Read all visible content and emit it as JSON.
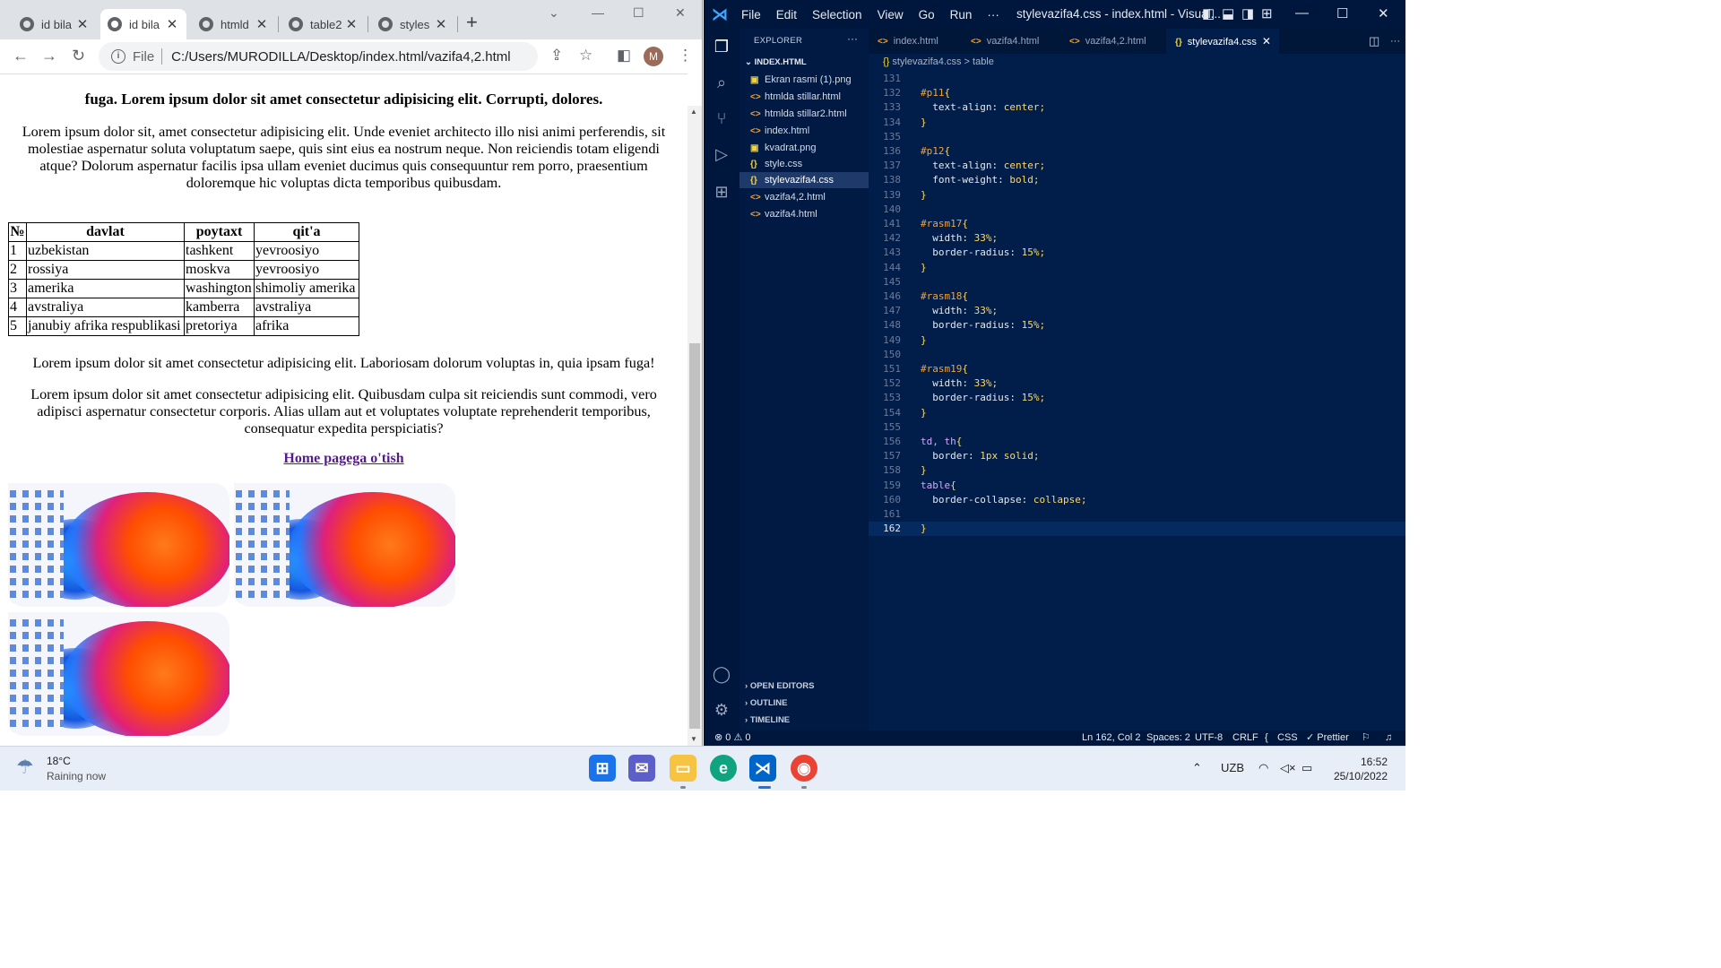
{
  "browser": {
    "tabs": [
      {
        "label": "id bila"
      },
      {
        "label": "id bila"
      },
      {
        "label": "htmld"
      },
      {
        "label": "table2"
      },
      {
        "label": "styles"
      }
    ],
    "new_tab": "+",
    "address_scheme": "File",
    "address": "C:/Users/MURODILLA/Desktop/index.html/vazifa4,2.html",
    "profile_initial": "M",
    "page": {
      "cut_heading": "fuga. Lorem ipsum dolor sit amet consectetur adipisicing elit. Corrupti, dolores.",
      "para1": "Lorem ipsum dolor sit, amet consectetur adipisicing elit. Unde eveniet architecto illo nisi animi perferendis, sit molestiae aspernatur soluta voluptatum saepe, quis sint eius ea nostrum neque. Non reiciendis totam eligendi atque? Dolorum aspernatur facilis ipsa ullam eveniet ducimus quis consequuntur rem porro, praesentium doloremque hic voluptas dicta temporibus quibusdam.",
      "table": {
        "headers": [
          "№",
          "davlat",
          "poytaxt",
          "qit'a"
        ],
        "rows": [
          [
            "1",
            "uzbekistan",
            "tashkent",
            "yevroosiyo"
          ],
          [
            "2",
            "rossiya",
            "moskva",
            "yevroosiyo"
          ],
          [
            "3",
            "amerika",
            "washington",
            "shimoliy amerika"
          ],
          [
            "4",
            "avstraliya",
            "kamberra",
            "avstraliya"
          ],
          [
            "5",
            "janubiy afrika respublikasi",
            "pretoriya",
            "afrika"
          ]
        ]
      },
      "para2": "Lorem ipsum dolor sit amet consectetur adipisicing elit. Laboriosam dolorum voluptas in, quia ipsam fuga!",
      "para3": "Lorem ipsum dolor sit amet consectetur adipisicing elit. Quibusdam culpa sit reiciendis sunt commodi, vero adipisci aspernatur consectetur corporis. Alias ullam aut et voluptates voluptate reprehenderit temporibus, consequatur expedita perspiciatis?",
      "home_link": "Home pagega o'tish"
    }
  },
  "vscode": {
    "menu": [
      "File",
      "Edit",
      "Selection",
      "View",
      "Go",
      "Run",
      "···"
    ],
    "title": "stylevazifa4.css - index.html - Visual...",
    "explorer_label": "EXPLORER",
    "explorer_more": "···",
    "folder": "INDEX.HTML",
    "files": [
      {
        "name": "Ekran rasmi (1).png",
        "icon": "image-icon"
      },
      {
        "name": "htmlda stillar.html",
        "icon": "html-icon"
      },
      {
        "name": "htmlda stillar2.html",
        "icon": "html-icon"
      },
      {
        "name": "index.html",
        "icon": "html-icon"
      },
      {
        "name": "kvadrat.png",
        "icon": "image-icon"
      },
      {
        "name": "style.css",
        "icon": "css-icon"
      },
      {
        "name": "stylevazifa4.css",
        "icon": "css-icon"
      },
      {
        "name": "vazifa4,2.html",
        "icon": "html-icon"
      },
      {
        "name": "vazifa4.html",
        "icon": "html-icon"
      }
    ],
    "sections": [
      "OPEN EDITORS",
      "OUTLINE",
      "TIMELINE"
    ],
    "editor_tabs": [
      "index.html",
      "vazifa4.html",
      "vazifa4,2.html",
      "stylevazifa4.css"
    ],
    "breadcrumb": {
      "file": "stylevazifa4.css",
      "sep": ">",
      "symbol": "table"
    },
    "code": [
      {
        "n": "131",
        "t": ""
      },
      {
        "n": "132",
        "t": "#p11{"
      },
      {
        "n": "133",
        "t": "  text-align: center;"
      },
      {
        "n": "134",
        "t": "}"
      },
      {
        "n": "135",
        "t": ""
      },
      {
        "n": "136",
        "t": "#p12{"
      },
      {
        "n": "137",
        "t": "  text-align: center;"
      },
      {
        "n": "138",
        "t": "  font-weight: bold;"
      },
      {
        "n": "139",
        "t": "}"
      },
      {
        "n": "140",
        "t": ""
      },
      {
        "n": "141",
        "t": "#rasm17{"
      },
      {
        "n": "142",
        "t": "  width: 33%;"
      },
      {
        "n": "143",
        "t": "  border-radius: 15%;"
      },
      {
        "n": "144",
        "t": "}"
      },
      {
        "n": "145",
        "t": ""
      },
      {
        "n": "146",
        "t": "#rasm18{"
      },
      {
        "n": "147",
        "t": "  width: 33%;"
      },
      {
        "n": "148",
        "t": "  border-radius: 15%;"
      },
      {
        "n": "149",
        "t": "}"
      },
      {
        "n": "150",
        "t": ""
      },
      {
        "n": "151",
        "t": "#rasm19{"
      },
      {
        "n": "152",
        "t": "  width: 33%;"
      },
      {
        "n": "153",
        "t": "  border-radius: 15%;"
      },
      {
        "n": "154",
        "t": "}"
      },
      {
        "n": "155",
        "t": ""
      },
      {
        "n": "156",
        "t": "td, th{"
      },
      {
        "n": "157",
        "t": "  border: 1px solid;"
      },
      {
        "n": "158",
        "t": "}"
      },
      {
        "n": "159",
        "t": "table{"
      },
      {
        "n": "160",
        "t": "  border-collapse: collapse;"
      },
      {
        "n": "161",
        "t": ""
      },
      {
        "n": "162",
        "t": "}"
      }
    ],
    "status": {
      "problems": "⊗ 0 ⚠ 0",
      "position": "Ln 162, Col 2",
      "spaces": "Spaces: 2",
      "encoding": "UTF-8",
      "eol": "CRLF",
      "language": "CSS",
      "prettier": "✓ Prettier"
    }
  },
  "taskbar": {
    "temperature": "18°C",
    "weather": "Raining now",
    "language": "UZB",
    "time": "16:52",
    "date": "25/10/2022"
  }
}
